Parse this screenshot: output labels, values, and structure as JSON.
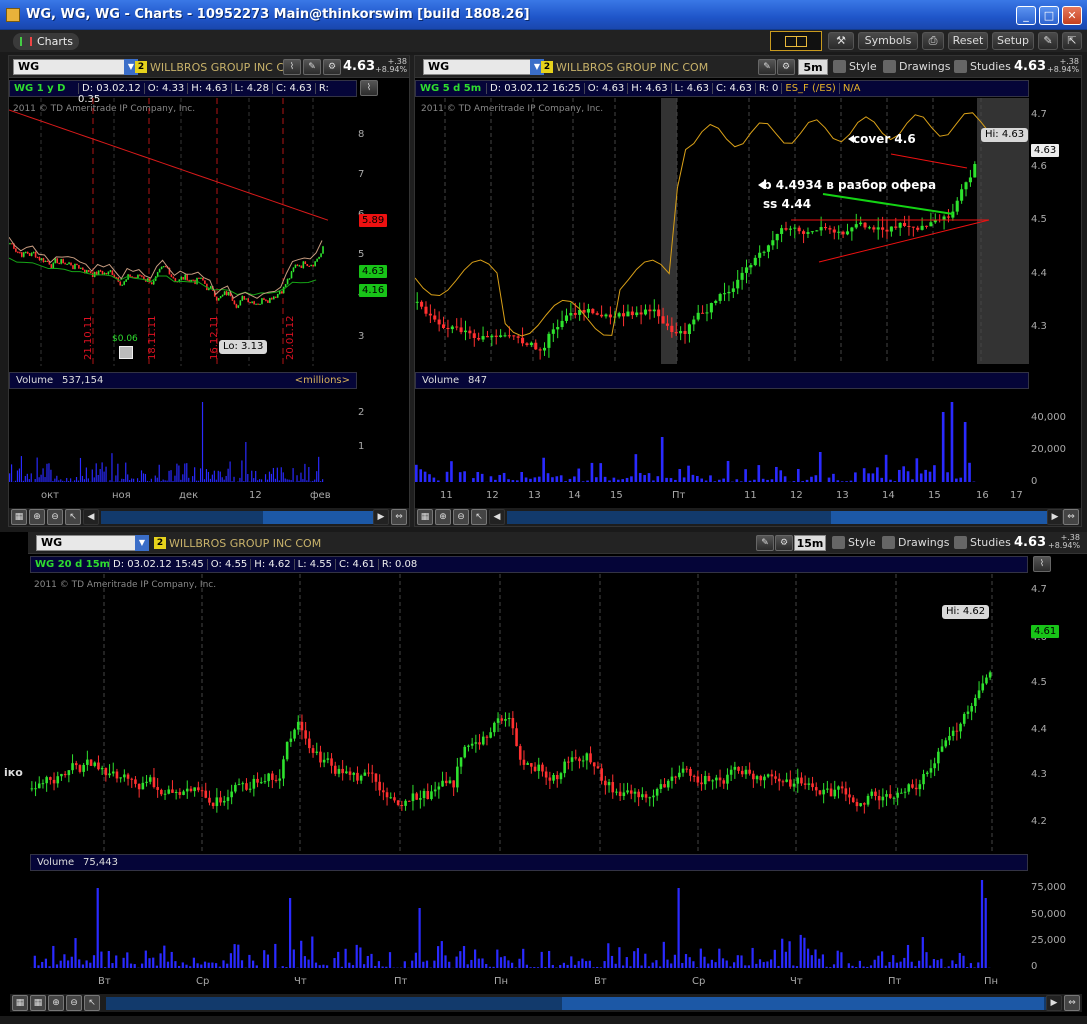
{
  "window": {
    "title": "WG, WG, WG - Charts - 10952273 Main@thinkorswim [build 1808.26]",
    "minimize": "_",
    "maximize": "□",
    "close": "✕"
  },
  "toolbar": {
    "charts_tab": "Charts",
    "symbols": "Symbols",
    "reset": "Reset",
    "setup": "Setup"
  },
  "panel1": {
    "symbol": "WG",
    "badge": "2",
    "company": "WILLBROS GROUP INC C...",
    "price": "4.63",
    "chg1": "+.38",
    "chg2": "+8.94%",
    "info_title": "WG 1 y D",
    "info": {
      "d": "D: 03.02.12",
      "o": "O: 4.33",
      "h": "H: 4.63",
      "l": "L: 4.28",
      "c": "C: 4.63",
      "r": "R: 0.35"
    },
    "copyright": "2011 © TD Ameritrade IP Company, Inc.",
    "y_ticks": [
      "8",
      "7",
      "6",
      "5",
      "4",
      "3"
    ],
    "tags": {
      "red": "5.89",
      "green1": "4.63",
      "green2": "4.16"
    },
    "low_callout": "Lo: 3.13",
    "dividend": "$0.06",
    "vdates": [
      "21.10.11",
      "18.11.11",
      "16.12.11",
      "20.01.12"
    ],
    "volume_label": "Volume",
    "volume_value": "537,154",
    "volume_unit": "<millions>",
    "vol_ticks": [
      "2",
      "1"
    ],
    "x_labels": [
      "окт",
      "ноя",
      "дек",
      "12",
      "фев"
    ]
  },
  "panel2": {
    "symbol": "WG",
    "badge": "2",
    "company": "WILLBROS GROUP INC COM",
    "timeframe": "5m",
    "style": "Style",
    "drawings": "Drawings",
    "studies": "Studies",
    "price": "4.63",
    "chg1": "+.38",
    "chg2": "+8.94%",
    "info_title": "WG 5 d 5m",
    "info": {
      "d": "D: 03.02.12 16:25",
      "o": "O: 4.63",
      "h": "H: 4.63",
      "l": "L: 4.63",
      "c": "C: 4.63",
      "r": "R: 0",
      "es": "ES_F (/ES)",
      "na": "N/A"
    },
    "copyright": "2011 © TD Ameritrade IP Company, Inc.",
    "y_ticks": [
      "4.7",
      "4.6",
      "4.5",
      "4.4",
      "4.3"
    ],
    "tag": "4.63",
    "hi_callout": "Hi: 4.63",
    "ann_cover": "cover 4.6",
    "ann_buy": "b 4.4934 в разбор офера",
    "ann_ss": "ss 4.44",
    "volume_label": "Volume",
    "volume_value": "847",
    "vol_ticks": [
      "40,000",
      "20,000",
      "0"
    ],
    "x_labels": [
      "11",
      "12",
      "13",
      "14",
      "15",
      "Пт",
      "11",
      "12",
      "13",
      "14",
      "15",
      "16",
      "17"
    ]
  },
  "panel3": {
    "symbol": "WG",
    "badge": "2",
    "company": "WILLBROS GROUP INC COM",
    "timeframe": "15m",
    "style": "Style",
    "drawings": "Drawings",
    "studies": "Studies",
    "price": "4.63",
    "chg1": "+.38",
    "chg2": "+8.94%",
    "info_title": "WG 20 d 15m",
    "info": {
      "d": "D: 03.02.12 15:45",
      "o": "O: 4.55",
      "h": "H: 4.62",
      "l": "L: 4.55",
      "c": "C: 4.61",
      "r": "R: 0.08"
    },
    "copyright": "2011 © TD Ameritrade IP Company, Inc.",
    "y_ticks": [
      "4.7",
      "4.6",
      "4.5",
      "4.4",
      "4.3",
      "4.2"
    ],
    "tag": "4.61",
    "hi_callout": "Hi: 4.62",
    "left_cut": "іко",
    "volume_label": "Volume",
    "volume_value": "75,443",
    "vol_ticks": [
      "75,000",
      "50,000",
      "25,000",
      "0"
    ],
    "x_labels": [
      "Вт",
      "Ср",
      "Чт",
      "Пт",
      "Пн",
      "Вт",
      "Ср",
      "Чт",
      "Пт",
      "Пн"
    ]
  },
  "colors": {
    "bull": "#2ee22e",
    "bear": "#ff3030",
    "sma_red": "#d81a1a",
    "sma_green": "#16a516",
    "es_line": "#d9a018",
    "volume": "#2a2aff"
  }
}
